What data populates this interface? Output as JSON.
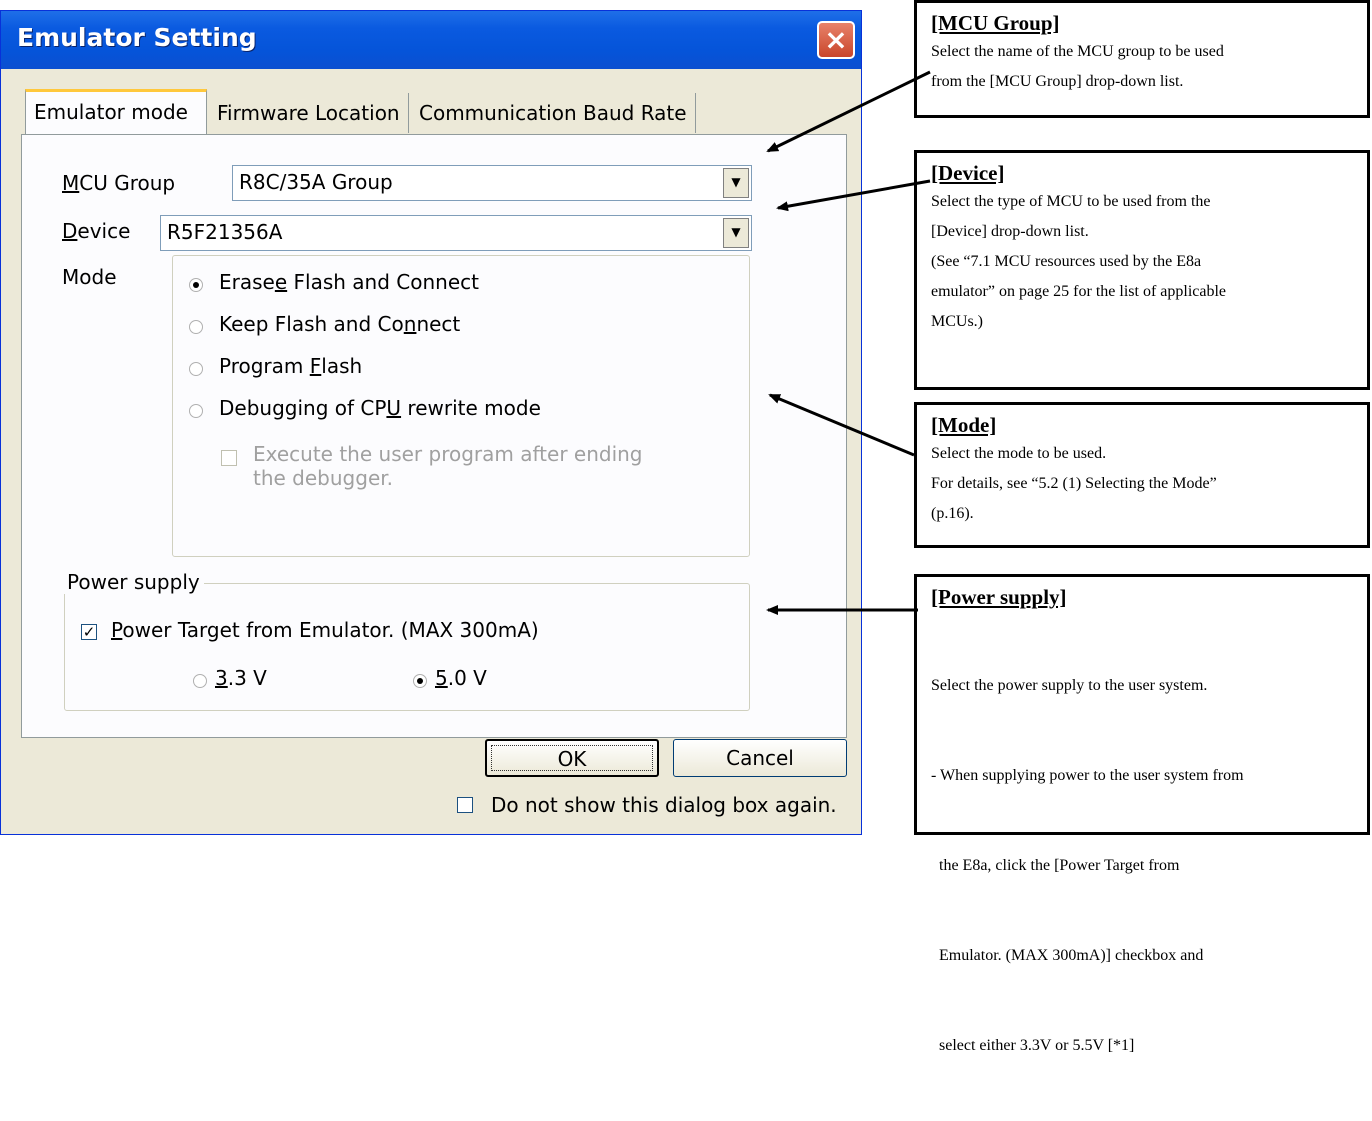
{
  "dialog": {
    "title": "Emulator Setting",
    "close_glyph": "×",
    "tabs": [
      "Emulator mode",
      "Firmware Location",
      "Communication Baud Rate"
    ],
    "mcu_group": {
      "label": "MCU Group",
      "accesskey": "M",
      "label_rest": "CU Group",
      "value": "R8C/35A Group"
    },
    "device": {
      "label": "Device",
      "accesskey": "D",
      "label_rest": "evice",
      "value": "R5F21356A"
    },
    "mode": {
      "label": "Mode",
      "options": [
        {
          "pre": "Erase",
          "key": "e",
          "post": " Flash and Connect",
          "selected": true
        },
        {
          "pre": "Keep Flash and Co",
          "key": "n",
          "post": "nect",
          "selected": false
        },
        {
          "pre": "Program ",
          "key": "F",
          "post": "lash",
          "selected": false
        },
        {
          "pre": "Debugging of CP",
          "key": "U",
          "post": " rewrite mode",
          "selected": false
        }
      ],
      "execute_checkbox": {
        "line1": "Execute the user program after ending",
        "line2": "the debugger.",
        "checked": false,
        "enabled": false
      }
    },
    "power_supply": {
      "caption": "Power supply",
      "checkbox": {
        "key": "P",
        "rest": "ower Target from Emulator. (MAX 300mA)",
        "checked": true
      },
      "voltages": [
        {
          "key": "3",
          "rest": ".3 V",
          "selected": false
        },
        {
          "key": "5",
          "rest": ".0 V",
          "selected": true
        }
      ]
    },
    "ok_label": "OK",
    "cancel_label": "Cancel",
    "dont_show_label": "Do not show this dialog box again.",
    "check_glyph": "✓",
    "dropdown_glyph": "▼"
  },
  "annotations": {
    "mcu_group": {
      "title": "[MCU Group]",
      "lines": [
        "Select the name of the MCU group to be used",
        "from the [MCU Group] drop-down list."
      ]
    },
    "device": {
      "title": "[Device]",
      "lines": [
        "Select the type of MCU to be used from the",
        "[Device] drop-down list.",
        "(See “7.1 MCU resources used by the E8a",
        "emulator” on page 25 for the list of applicable",
        "MCUs.)"
      ]
    },
    "mode": {
      "title": "[Mode]",
      "lines": [
        "Select the mode to be used.",
        "For details, see “5.2 (1) Selecting the Mode”",
        "(p.16)."
      ]
    },
    "power_supply": {
      "title": "[Power supply]",
      "lines": [
        "Select the power supply to the user system.",
        "- When supplying power to the user system from",
        "  the E8a, click the [Power Target from",
        "  Emulator. (MAX 300mA)] checkbox and",
        "  select either 3.3V or 5.5V [*1]"
      ]
    }
  }
}
